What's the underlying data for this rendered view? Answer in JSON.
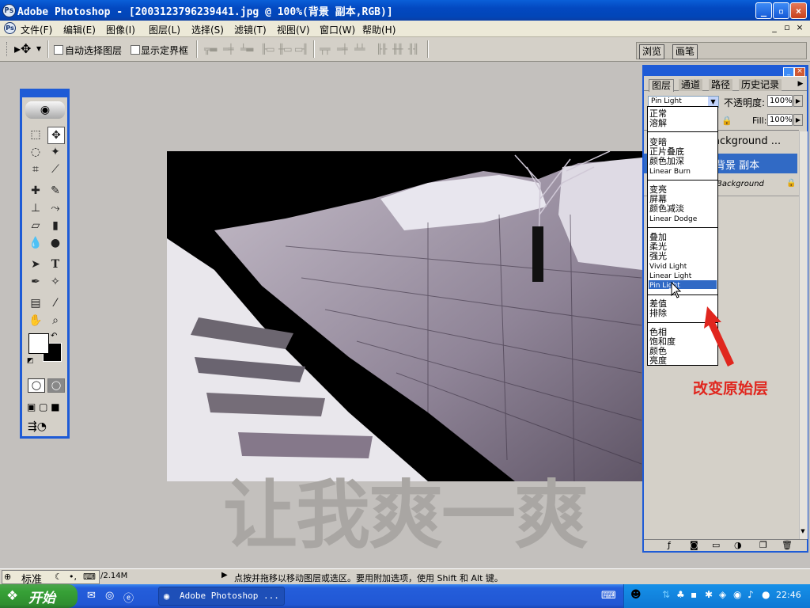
{
  "window": {
    "title": "Adobe Photoshop - [2003123796239441.jpg @ 100%(背景 副本,RGB)]",
    "controls": {
      "minimize": "_",
      "restore": "▫",
      "close": "×"
    }
  },
  "menu": {
    "items": [
      "文件(F)",
      "编辑(E)",
      "图像(I)",
      "图层(L)",
      "选择(S)",
      "滤镜(T)",
      "视图(V)",
      "窗口(W)",
      "帮助(H)"
    ],
    "doc_controls": {
      "minimize": "_",
      "restore": "▫",
      "close": "×"
    }
  },
  "options": {
    "auto_select_label": "自动选择图层",
    "show_bounds_label": "显示定界框",
    "browser_tab": "浏览",
    "brush_tab": "画笔"
  },
  "layers_panel": {
    "tabs": [
      "图层",
      "通道",
      "路径",
      "历史记录"
    ],
    "blend_mode": "Pin Light",
    "opacity_label": "不透明度:",
    "opacity_value": "100%",
    "fill_label": "Fill:",
    "fill_value": "100%",
    "layers": [
      {
        "name": "ackground ...",
        "selected": false
      },
      {
        "name": "背景 副本",
        "selected": true
      },
      {
        "name": "Background",
        "selected": false
      }
    ]
  },
  "blend_menu": {
    "groups": [
      [
        "正常",
        "溶解"
      ],
      [
        "变暗",
        "正片叠底",
        "颜色加深",
        "Linear Burn"
      ],
      [
        "变亮",
        "屏幕",
        "颜色减淡",
        "Linear Dodge"
      ],
      [
        "叠加",
        "柔光",
        "强光",
        "Vivid Light",
        "Linear Light",
        "Pin Light"
      ],
      [
        "差值",
        "排除"
      ],
      [
        "色相",
        "饱和度",
        "颜色",
        "亮度"
      ]
    ],
    "highlighted": "Pin Light"
  },
  "annotation": {
    "red_label": "改变原始层",
    "watermark": "让我爽一爽",
    "arrow_color": "#e0261e"
  },
  "status": {
    "doc_size": "/2.14M",
    "hint": "点按并拖移以移动图层或选区。要用附加选项，使用 Shift 和 Alt 键。",
    "ime_label": "标准"
  },
  "taskbar": {
    "start_label": "开始",
    "app_button": "Adobe Photoshop ...",
    "clock": "22:46"
  },
  "colors": {
    "xp_blue": "#0348c0",
    "canvas_bg": "#c3c0bd",
    "panel_border": "#1e5bd6",
    "selected_layer": "#316ac5"
  }
}
